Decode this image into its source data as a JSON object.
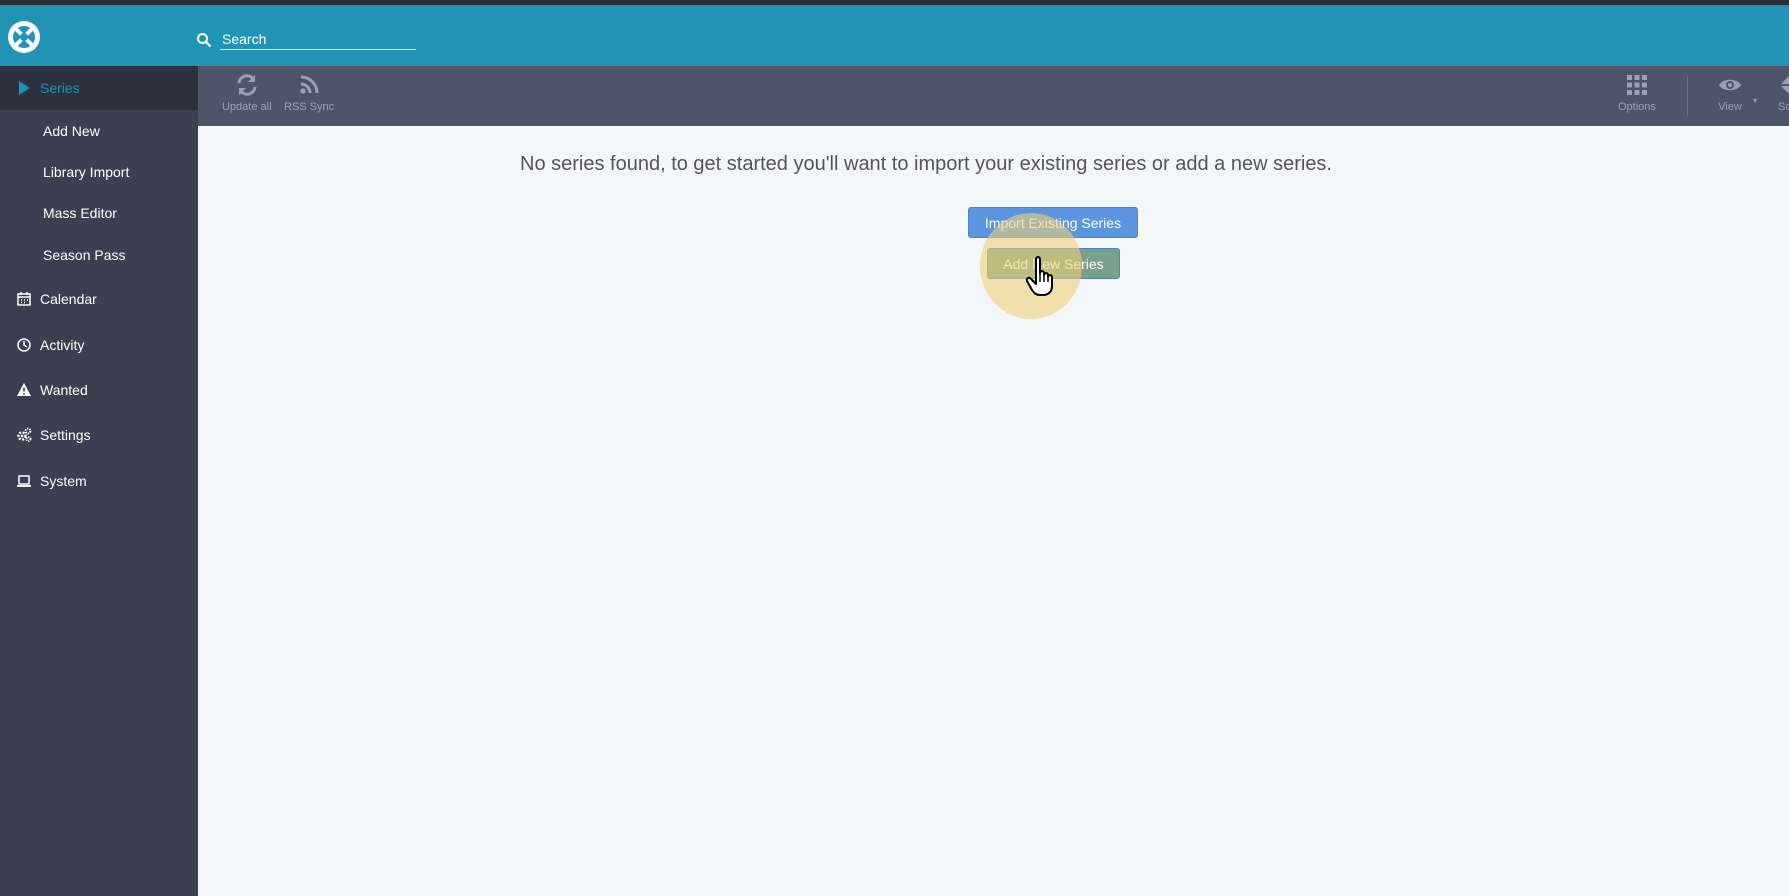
{
  "header": {
    "logo_icon": "sonarr-logo-icon",
    "search_icon": "search-icon",
    "search_placeholder": "Search"
  },
  "sidebar": {
    "items": [
      {
        "label": "Series",
        "icon": "play-icon",
        "active": true
      },
      {
        "label": "Add New"
      },
      {
        "label": "Library Import"
      },
      {
        "label": "Mass Editor"
      },
      {
        "label": "Season Pass"
      },
      {
        "label": "Calendar",
        "icon": "calendar-icon"
      },
      {
        "label": "Activity",
        "icon": "clock-icon"
      },
      {
        "label": "Wanted",
        "icon": "warning-icon"
      },
      {
        "label": "Settings",
        "icon": "gears-icon"
      },
      {
        "label": "System",
        "icon": "laptop-icon"
      }
    ]
  },
  "toolbar": {
    "update_all": "Update all",
    "rss_sync": "RSS Sync",
    "options": "Options",
    "view": "View",
    "sort": "So"
  },
  "main": {
    "message": "No series found, to get started you'll want to import your existing series or add a new series.",
    "import_button": "Import Existing Series",
    "add_button": "Add New Series"
  },
  "colors": {
    "header": "#2193b5",
    "sidebar": "#3a3f51",
    "toolbar": "#4e5568",
    "button": "#5b95e0"
  }
}
